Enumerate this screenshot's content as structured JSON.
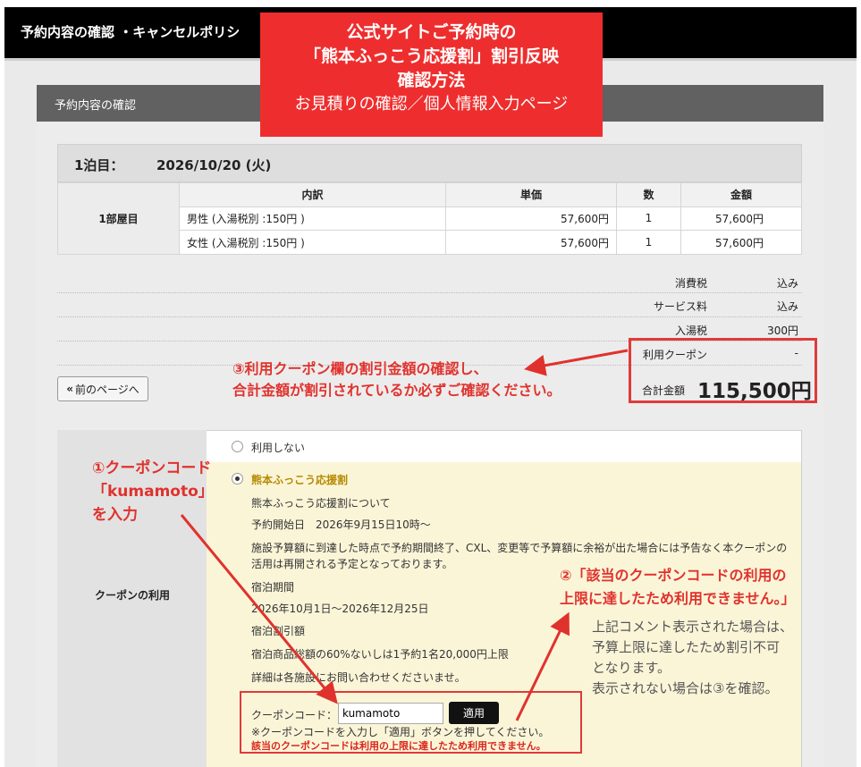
{
  "header": {
    "title": "予約内容の確認 ・キャンセルポリシ"
  },
  "callout": {
    "line1": "公式サイトご予約時の",
    "line2": "「熊本ふっこう応援割」割引反映",
    "line3": "確認方法",
    "line4": "お見積りの確認／個人情報入力ページ"
  },
  "panel": {
    "title": "予約内容の確認"
  },
  "night": {
    "label": "1泊目：",
    "date": "2026/10/20 (火)"
  },
  "rooms_table": {
    "room_label": "1部屋目",
    "headers": [
      "内訳",
      "単価",
      "数",
      "金額"
    ],
    "rows": [
      [
        "男性 (入湯税別 :150円 )",
        "57,600円",
        "1",
        "57,600円"
      ],
      [
        "女性 (入湯税別 :150円 )",
        "57,600円",
        "1",
        "57,600円"
      ]
    ]
  },
  "summary": {
    "tax_label": "消費税",
    "tax_value": "込み",
    "service_label": "サービス料",
    "service_value": "込み",
    "bath_tax_label": "入湯税",
    "bath_tax_value": "300円",
    "coupon_label": "利用クーポン",
    "coupon_value": "-",
    "total_label": "合計金額",
    "total_value": "115,500円"
  },
  "back_button": {
    "icon": "double-chevron-left-icon",
    "label": "前のページへ"
  },
  "coupon": {
    "section_label": "クーポンの利用",
    "option_none": "利用しない",
    "option_name": "熊本ふっこう応援割",
    "about": "熊本ふっこう応援割について",
    "start": "予約開始日　2026年9月15日10時～",
    "note_line1": "施設予算額に到達した時点で予約期間終了、CXL、変更等で予算額に余裕が出た場合には予告なく本クーポンの",
    "note_line2": "活用は再開される予定となっております。",
    "stay_period_label": "宿泊期間",
    "stay_period": "2026年10月1日～2026年12月25日",
    "discount_label": "宿泊割引額",
    "discount": "宿泊商品総額の60%ないしは1予約1名20,000円上限",
    "contact": "詳細は各施設にお問い合わせくださいませ。",
    "code_label": "クーポンコード：",
    "code_value": "kumamoto",
    "apply_label": "適用",
    "hint": "※クーポンコードを入力し「適用」ボタンを押してください。",
    "error": "該当のクーポンコードは利用の上限に達したため利用できません。"
  },
  "annotations": {
    "note1_line1": "①クーポンコード",
    "note1_line2": "「kumamoto」",
    "note1_line3": "を入力",
    "note2_line1": "②「該当のクーポンコードの利用の",
    "note2_line2": "上限に達したため利用できません。」",
    "note3_line1": "③利用クーポン欄の割引金額の確認し、",
    "note3_line2": "合計金額が割引されているか必ずご確認ください。",
    "gray_line1": "上記コメント表示された場合は、",
    "gray_line2": "予算上限に達したため割引不可",
    "gray_line3": "となります。",
    "gray_line4": "表示されない場合は③を確認。"
  },
  "colors": {
    "accent_red": "#ee2e2e",
    "header_bg": "#000000",
    "panel_head": "#616161",
    "coupon_bg": "#fbf5d8"
  }
}
